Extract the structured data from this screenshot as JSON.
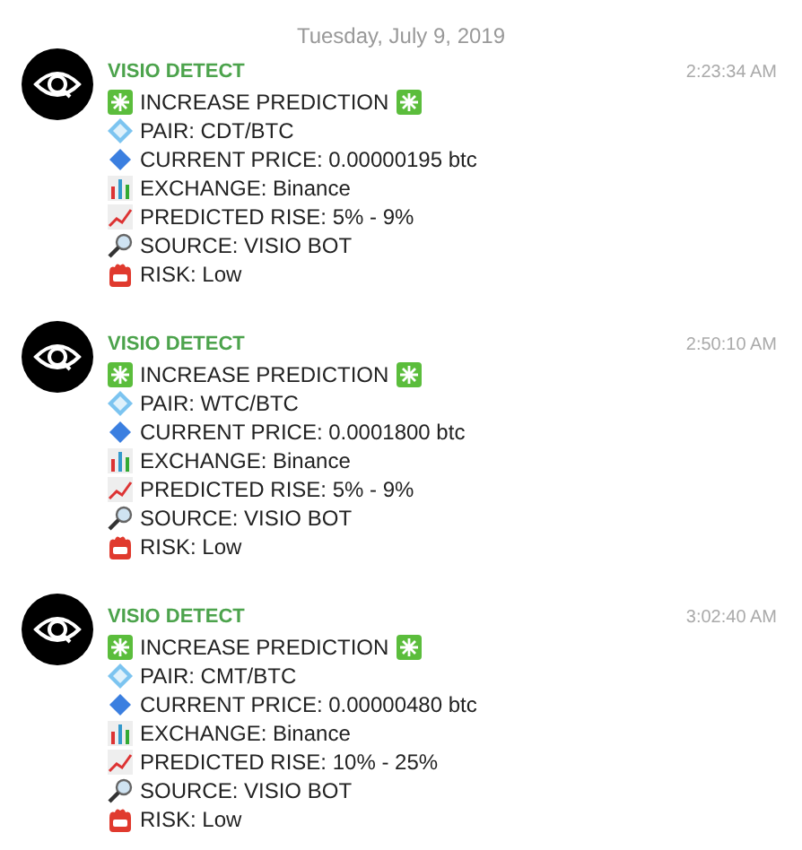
{
  "date": "Tuesday, July 9, 2019",
  "messages": [
    {
      "sender": "VISIO DETECT",
      "time": "2:23:34 AM",
      "lines": [
        {
          "kind": "headline",
          "text": "INCREASE PREDICTION"
        },
        {
          "kind": "pair",
          "text": "PAIR: CDT/BTC"
        },
        {
          "kind": "price",
          "text": "CURRENT PRICE: 0.00000195 btc"
        },
        {
          "kind": "exchange",
          "text": "EXCHANGE: Binance"
        },
        {
          "kind": "rise",
          "text": "PREDICTED RISE: 5% - 9%"
        },
        {
          "kind": "source",
          "text": "SOURCE: VISIO BOT"
        },
        {
          "kind": "risk",
          "text": "RISK: Low"
        }
      ]
    },
    {
      "sender": "VISIO DETECT",
      "time": "2:50:10 AM",
      "lines": [
        {
          "kind": "headline",
          "text": "INCREASE PREDICTION"
        },
        {
          "kind": "pair",
          "text": "PAIR: WTC/BTC"
        },
        {
          "kind": "price",
          "text": "CURRENT PRICE: 0.0001800 btc"
        },
        {
          "kind": "exchange",
          "text": "EXCHANGE: Binance"
        },
        {
          "kind": "rise",
          "text": "PREDICTED RISE: 5% - 9%"
        },
        {
          "kind": "source",
          "text": "SOURCE: VISIO BOT"
        },
        {
          "kind": "risk",
          "text": "RISK: Low"
        }
      ]
    },
    {
      "sender": "VISIO DETECT",
      "time": "3:02:40 AM",
      "lines": [
        {
          "kind": "headline",
          "text": "INCREASE PREDICTION"
        },
        {
          "kind": "pair",
          "text": "PAIR: CMT/BTC"
        },
        {
          "kind": "price",
          "text": "CURRENT PRICE: 0.00000480 btc"
        },
        {
          "kind": "exchange",
          "text": "EXCHANGE: Binance"
        },
        {
          "kind": "rise",
          "text": "PREDICTED RISE: 10% - 25%"
        },
        {
          "kind": "source",
          "text": "SOURCE: VISIO BOT"
        },
        {
          "kind": "risk",
          "text": "RISK: Low"
        }
      ]
    }
  ]
}
